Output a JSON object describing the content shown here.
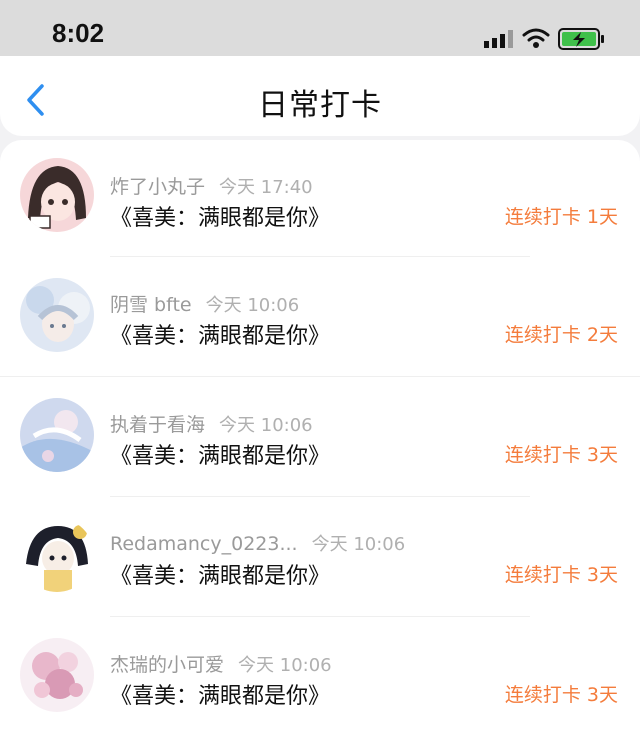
{
  "status_bar": {
    "time": "8:02",
    "icons": [
      "cellular-signal-icon",
      "wifi-icon",
      "battery-charging-icon"
    ]
  },
  "header": {
    "title": "日常打卡",
    "back_icon": "chevron-left-icon"
  },
  "colors": {
    "accent_blue": "#2f8ff0",
    "streak_orange": "#f47c3c",
    "muted_text": "#9a9a9a"
  },
  "checkins": [
    {
      "user": "炸了小丸子",
      "time": "今天 17:40",
      "book": "《喜美：满眼都是你》",
      "streak": "连续打卡 1天"
    },
    {
      "user": "阴雪 bfte",
      "time": "今天 10:06",
      "book": "《喜美：满眼都是你》",
      "streak": "连续打卡 2天"
    },
    {
      "user": "执着于看海",
      "time": "今天 10:06",
      "book": "《喜美：满眼都是你》",
      "streak": "连续打卡 3天"
    },
    {
      "user": "Redamancy_0223...",
      "time": "今天 10:06",
      "book": "《喜美：满眼都是你》",
      "streak": "连续打卡 3天"
    },
    {
      "user": "杰瑞的小可爱",
      "time": "今天 10:06",
      "book": "《喜美：满眼都是你》",
      "streak": "连续打卡 3天"
    }
  ]
}
